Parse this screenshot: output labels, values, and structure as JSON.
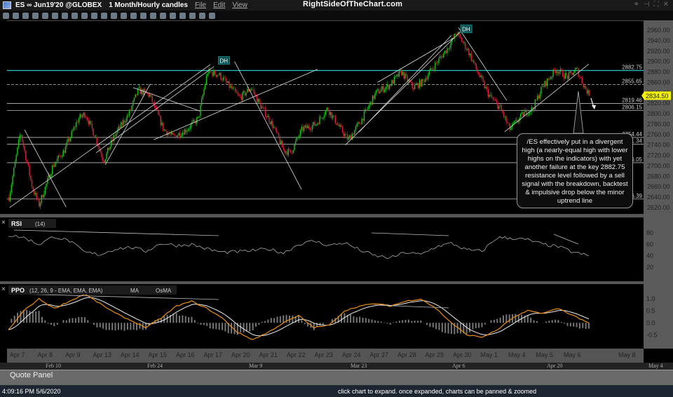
{
  "window": {
    "symbol": "ES ∞ Jun19'20 @GLOBEX",
    "timeframe": "1 Month/Hourly candles",
    "menus": [
      "File",
      "Edit",
      "View"
    ],
    "brand": "RightSideOfTheChart.com"
  },
  "colors": {
    "up": "#19c519",
    "down": "#e0203a",
    "resistance": "#1fc7c7",
    "price_badge": "#f0f000",
    "orange": "#e8901a"
  },
  "chart_data": [
    {
      "type": "candlestick",
      "panel": "price",
      "ylim": [
        2610,
        2970
      ],
      "yticks": [
        2620,
        2640,
        2660,
        2680,
        2700,
        2720,
        2740,
        2760,
        2780,
        2800,
        2820,
        2840,
        2860,
        2880,
        2900,
        2920,
        2940,
        2960
      ],
      "ytick_labels": [
        "2620.00",
        "2640.00",
        "2660.00",
        "2680.00",
        "2700.00",
        "2720.00",
        "2740.00",
        "2760.00",
        "2780.00",
        "2800.00",
        "2820.00",
        "2840.00",
        "2860.00",
        "2880.00",
        "2900.00",
        "2920.00",
        "2940.00",
        "2960.00"
      ],
      "x_dates": [
        "Apr 7",
        "Apr 8",
        "Apr 9",
        "Apr 13",
        "Apr 14",
        "Apr 15",
        "Apr 16",
        "Apr 17",
        "Apr 20",
        "Apr 21",
        "Apr 22",
        "Apr 23",
        "Apr 24",
        "Apr 27",
        "Apr 28",
        "Apr 29",
        "Apr 30",
        "May 1",
        "May 4",
        "May 5",
        "May 6"
      ],
      "x_extra_label": "May 8",
      "last_price": "2834.50",
      "close_path": [
        [
          "Apr 7",
          0,
          2640
        ],
        [
          "Apr 7",
          10,
          2765
        ],
        [
          "Apr 7",
          20,
          2660
        ],
        [
          "Apr 8",
          2,
          2625
        ],
        [
          "Apr 8",
          14,
          2700
        ],
        [
          "Apr 9",
          0,
          2730
        ],
        [
          "Apr 9",
          12,
          2790
        ],
        [
          "Apr 9",
          18,
          2800
        ],
        [
          "Apr 13",
          2,
          2760
        ],
        [
          "Apr 13",
          10,
          2710
        ],
        [
          "Apr 13",
          20,
          2760
        ],
        [
          "Apr 14",
          8,
          2800
        ],
        [
          "Apr 14",
          16,
          2845
        ],
        [
          "Apr 15",
          2,
          2835
        ],
        [
          "Apr 15",
          14,
          2770
        ],
        [
          "Apr 15",
          22,
          2755
        ],
        [
          "Apr 16",
          10,
          2770
        ],
        [
          "Apr 16",
          20,
          2790
        ],
        [
          "Apr 17",
          4,
          2880
        ],
        [
          "Apr 17",
          14,
          2875
        ],
        [
          "Apr 17",
          22,
          2855
        ],
        [
          "Apr 20",
          8,
          2830
        ],
        [
          "Apr 20",
          18,
          2850
        ],
        [
          "Apr 21",
          2,
          2815
        ],
        [
          "Apr 21",
          12,
          2780
        ],
        [
          "Apr 21",
          22,
          2730
        ],
        [
          "Apr 22",
          4,
          2725
        ],
        [
          "Apr 22",
          14,
          2770
        ],
        [
          "Apr 23",
          2,
          2780
        ],
        [
          "Apr 23",
          12,
          2810
        ],
        [
          "Apr 23",
          22,
          2775
        ],
        [
          "Apr 24",
          6,
          2750
        ],
        [
          "Apr 24",
          18,
          2790
        ],
        [
          "Apr 27",
          6,
          2840
        ],
        [
          "Apr 27",
          18,
          2855
        ],
        [
          "Apr 28",
          4,
          2880
        ],
        [
          "Apr 28",
          14,
          2850
        ],
        [
          "Apr 28",
          22,
          2860
        ],
        [
          "Apr 29",
          8,
          2890
        ],
        [
          "Apr 29",
          20,
          2925
        ],
        [
          "Apr 30",
          4,
          2955
        ],
        [
          "Apr 30",
          14,
          2920
        ],
        [
          "Apr 30",
          22,
          2880
        ],
        [
          "May 1",
          8,
          2835
        ],
        [
          "May 1",
          18,
          2810
        ],
        [
          "May 4",
          2,
          2770
        ],
        [
          "May 4",
          14,
          2800
        ],
        [
          "May 4",
          22,
          2810
        ],
        [
          "May 5",
          6,
          2850
        ],
        [
          "May 5",
          18,
          2885
        ],
        [
          "May 6",
          4,
          2870
        ],
        [
          "May 6",
          12,
          2885
        ],
        [
          "May 6",
          18,
          2855
        ],
        [
          "May 6",
          23,
          2834.5
        ]
      ],
      "levels": [
        {
          "label": "2882.75",
          "price": 2882.75,
          "style": "resistance"
        },
        {
          "label": "2855.65",
          "price": 2855.65,
          "style": "dashed"
        },
        {
          "label": "2819.46",
          "price": 2819.46,
          "style": "solid"
        },
        {
          "label": "2806.15",
          "price": 2806.15,
          "style": "solid"
        },
        {
          "label": "2754.44",
          "price": 2754.44,
          "style": "solid"
        },
        {
          "label": "1.34",
          "price": 2741.34,
          "style": "solid"
        },
        {
          "label": "6.05",
          "price": 2706.05,
          "style": "solid"
        },
        {
          "label": "6.39",
          "price": 2636.39,
          "style": "solid"
        }
      ],
      "trendlines": [
        [
          [
            "Apr 7",
            1,
            2620
          ],
          [
            "Apr 17",
            7,
            2894
          ]
        ],
        [
          [
            "Apr 7",
            14,
            2769
          ],
          [
            "Apr 9",
            2,
            2621
          ]
        ],
        [
          [
            "Apr 13",
            12,
            2702
          ],
          [
            "Apr 15",
            3,
            2857
          ]
        ],
        [
          [
            "Apr 13",
            4,
            2725
          ],
          [
            "Apr 17",
            10,
            2890
          ]
        ],
        [
          [
            "Apr 14",
            12,
            2850
          ],
          [
            "Apr 16",
            22,
            2805
          ]
        ],
        [
          [
            "Apr 15",
            6,
            2750
          ],
          [
            "Apr 23",
            4,
            2885
          ]
        ],
        [
          [
            "Apr 20",
            4,
            2900
          ],
          [
            "Apr 22",
            14,
            2655
          ]
        ],
        [
          [
            "Apr 24",
            4,
            2740
          ],
          [
            "Apr 30",
            10,
            2962
          ]
        ],
        [
          [
            "Apr 24",
            16,
            2765
          ],
          [
            "Apr 30",
            0,
            2950
          ]
        ],
        [
          [
            "Apr 27",
            8,
            2860
          ],
          [
            "Apr 30",
            2,
            2945
          ]
        ],
        [
          [
            "Apr 30",
            6,
            2965
          ],
          [
            "May 4",
            0,
            2825
          ]
        ],
        [
          [
            "May 1",
            22,
            2765
          ],
          [
            "May 6",
            23,
            2895
          ]
        ]
      ],
      "annotations": [
        {
          "text": "DH",
          "date": "Apr 17",
          "hour": 14
        },
        {
          "text": "DH",
          "date": "Apr 30",
          "hour": 8
        }
      ],
      "callout": "/ES effectively put in a divergent high (a nearly-equal high with lower highs on the indicators) with yet another failure at the key 2882.75 resistance level followed by a sell signal with the breakdown, backtest & impulsive drop below the minor uptrend line"
    },
    {
      "type": "line",
      "panel": "RSI",
      "title": "RSI",
      "params": "(14)",
      "ylim": [
        0,
        100
      ],
      "yticks": [
        20,
        40,
        60,
        80
      ],
      "values": [
        76,
        72,
        60,
        74,
        66,
        46,
        42,
        52,
        55,
        48,
        62,
        58,
        60,
        52,
        46,
        47,
        49,
        52,
        45,
        60,
        66,
        58,
        63,
        50,
        40,
        36,
        46,
        42,
        56,
        62,
        50,
        48,
        72,
        71,
        68,
        60,
        56,
        46,
        40
      ]
    },
    {
      "type": "line",
      "panel": "PPO",
      "title": "PPO",
      "params": "(12, 26, 9 - EMA, EMA, EMA)",
      "legend": [
        "MA",
        "OsMA"
      ],
      "ylim": [
        -0.9,
        1.5
      ],
      "yticks": [
        -0.5,
        0.0,
        0.5,
        1.0
      ],
      "ytick_labels": [
        "-0.5",
        "0.0",
        "0.5",
        "1.0"
      ],
      "values": [
        -0.3,
        0.5,
        1.0,
        0.6,
        0.9,
        1.2,
        0.8,
        0.4,
        0.1,
        -0.2,
        0.2,
        0.7,
        0.9,
        0.6,
        0.2,
        -0.4,
        -0.7,
        -0.4,
        0.0,
        0.3,
        -0.2,
        -0.1,
        0.5,
        0.7,
        0.8,
        0.7,
        0.9,
        1.0,
        0.6,
        0.0,
        -0.5,
        -0.6,
        -0.3,
        0.2,
        0.5,
        0.4,
        0.6,
        0.3,
        0.0
      ]
    }
  ],
  "overview": {
    "dates": [
      "Feb 10",
      "Feb 24",
      "Mar 9",
      "Mar 23",
      "Apr 6",
      "Apr 20",
      "May 4"
    ]
  },
  "quote_panel": "Quote Panel",
  "status": {
    "time": "4:09:16 PM 5/6/2020",
    "hint": "click chart to expand. once expanded, charts can be panned & zoomed"
  }
}
